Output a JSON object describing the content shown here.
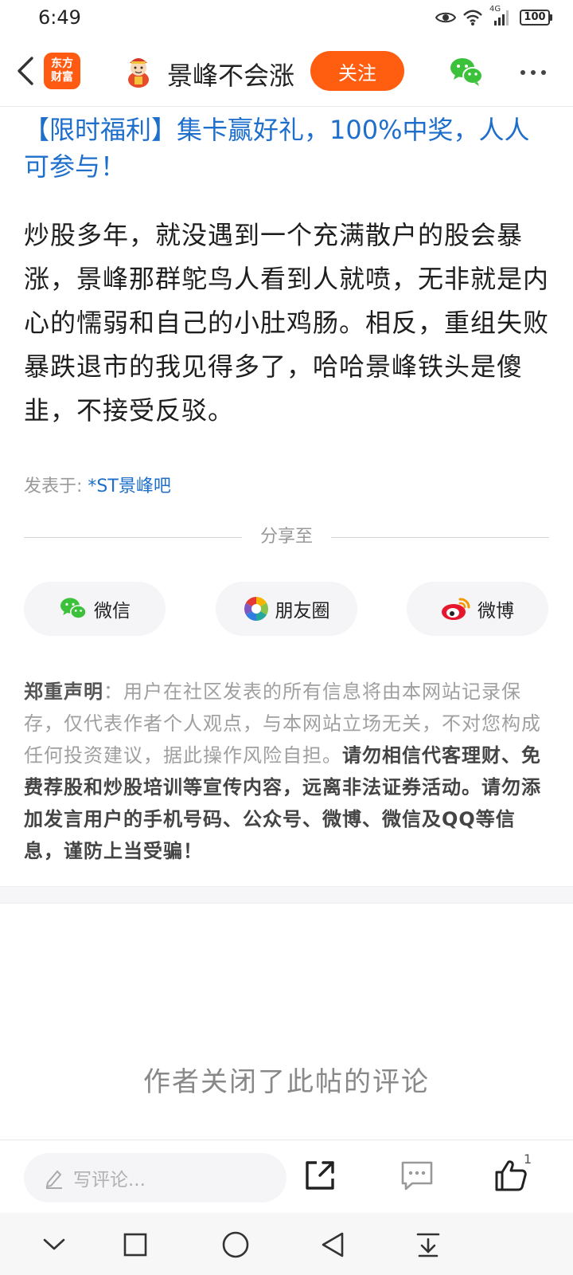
{
  "status_bar": {
    "time": "6:49",
    "network": "4G",
    "battery": "100",
    "icons": [
      "eye-icon",
      "wifi-icon",
      "signal-icon",
      "battery-icon"
    ]
  },
  "header": {
    "app_logo_line1": "东方",
    "app_logo_line2": "财富",
    "bar_name": "景峰不会涨",
    "follow_label": "关注",
    "icons": [
      "back-icon",
      "avatar-icon",
      "wechat-icon",
      "more-icon"
    ]
  },
  "post": {
    "promo": "【限时福利】集卡赢好礼，100%中奖，人人可参与！",
    "body": "炒股多年，就没遇到一个充满散户的股会暴涨，景峰那群鸵鸟人看到人就喷，无非就是内心的懦弱和自己的小肚鸡肠。相反，重组失败暴跌退市的我见得多了，哈哈景峰铁头是傻韭，不接受反驳。",
    "posted_in_label": "发表于:",
    "posted_in_bar": "*ST景峰吧"
  },
  "share": {
    "title": "分享至",
    "wechat": "微信",
    "moments": "朋友圈",
    "weibo": "微博"
  },
  "disclaimer": {
    "title": "郑重声明",
    "colon": "：",
    "normal": "用户在社区发表的所有信息将由本网站记录保存，仅代表作者个人观点，与本网站立场无关，不对您构成任何投资建议，据此操作风险自担。",
    "warning": "请勿相信代客理财、免费荐股和炒股培训等宣传内容，远离非法证券活动。请勿添加发言用户的手机号码、公众号、微博、微信及QQ等信息，谨防上当受骗！"
  },
  "comments": {
    "closed_text": "作者关闭了此帖的评论"
  },
  "action_bar": {
    "comment_placeholder": "写评论...",
    "like_count": "1",
    "colors": {
      "accent": "#ff5d10",
      "link": "#1e6fcc"
    }
  },
  "nav_bar": {
    "icons": [
      "collapse-icon",
      "recent-apps-icon",
      "home-icon",
      "back-nav-icon",
      "download-icon"
    ]
  }
}
